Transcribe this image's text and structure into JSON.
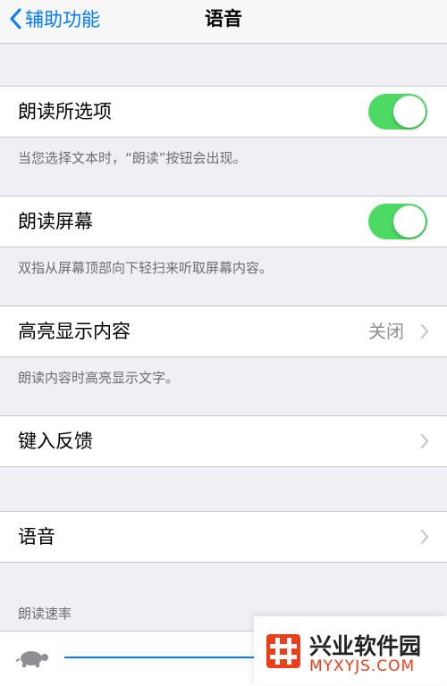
{
  "navbar": {
    "back_label": "辅助功能",
    "title": "语音"
  },
  "speak_selection": {
    "label": "朗读所选项",
    "enabled": true,
    "note": "当您选择文本时，“朗读”按钮会出现。"
  },
  "speak_screen": {
    "label": "朗读屏幕",
    "enabled": true,
    "note": "双指从屏幕顶部向下轻扫来听取屏幕内容。"
  },
  "highlight_content": {
    "label": "高亮显示内容",
    "value": "关闭",
    "note": "朗读内容时高亮显示文字。"
  },
  "typing_feedback": {
    "label": "键入反馈"
  },
  "voices": {
    "label": "语音"
  },
  "speaking_rate": {
    "header": "朗读速率",
    "value_fraction": 0.5
  },
  "watermark": {
    "title": "兴业软件园",
    "subtitle": "MYXYJS.COM"
  },
  "colors": {
    "accent": "#007aff",
    "toggle_on": "#4cd964",
    "background": "#efeff4",
    "watermark_brand": "#e8401c"
  },
  "icons": [
    "chevron-left-icon",
    "chevron-right-icon",
    "turtle-icon",
    "grid-logo-icon"
  ]
}
